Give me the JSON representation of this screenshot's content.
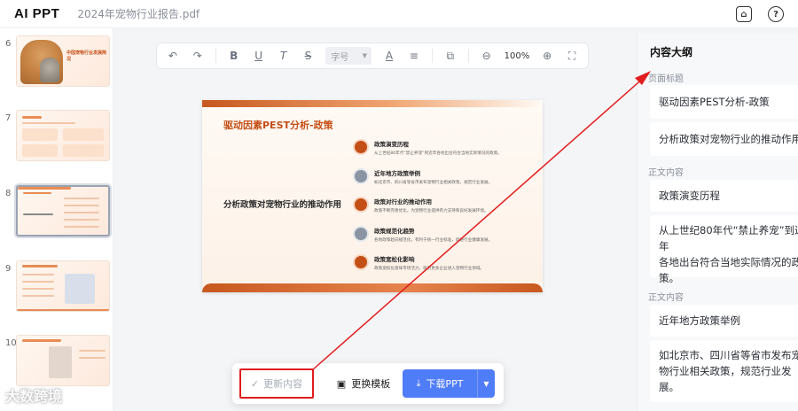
{
  "app": {
    "logo": "AI PPT",
    "filename": "2024年宠物行业报告.pdf"
  },
  "top_icons": [
    "home-icon",
    "help-icon"
  ],
  "thumbnails": [
    {
      "num": "6",
      "title": "中国宠物行业发展简况"
    },
    {
      "num": "7"
    },
    {
      "num": "8"
    },
    {
      "num": "9"
    },
    {
      "num": "10"
    }
  ],
  "toolbar": {
    "font_size_placeholder": "字号",
    "zoom": "100%",
    "buttons": [
      "undo-icon",
      "redo-icon",
      "bold-icon",
      "underline-icon",
      "italic-icon",
      "strikethrough-icon",
      "font-color-icon",
      "align-icon",
      "layout-icon",
      "zoom-out-icon",
      "zoom-in-icon",
      "fit-screen-icon"
    ]
  },
  "slide": {
    "title": "驱动因素PEST分析-政策",
    "subtitle": "分析政策对宠物行业的推动作用",
    "points": [
      {
        "heading": "政策演变历程",
        "desc": "从上世纪80年代“禁止养宠”到近年各地出台符合当地实际情况的政策。"
      },
      {
        "heading": "近年地方政策举例",
        "desc": "如北京市、四川省等省市发布宠物行业相关政策，规范行业发展。"
      },
      {
        "heading": "政策对行业的推动作用",
        "desc": "政策不断完善优化，为宠物行业提供有力支持和良好发展环境。"
      },
      {
        "heading": "政策规范化趋势",
        "desc": "各地政策趋向规范化，有利于统一行业标准，促进行业健康发展。"
      },
      {
        "heading": "政策宽松化影响",
        "desc": "政策宽松化意味市场活力，吸引更多企业进入宠物行业领域。"
      }
    ]
  },
  "outline": {
    "title": "内容大纲",
    "sections": [
      {
        "label": "页面标题",
        "cards": [
          "驱动因素PEST分析-政策",
          "分析政策对宠物行业的推动作用"
        ]
      },
      {
        "label": "正文内容",
        "cards": [
          "政策演变历程",
          "从上世纪80年代“禁止养宠”到近年\n各地出台符合当地实际情况的政\n策。"
        ]
      },
      {
        "label": "正文内容",
        "cards": [
          "近年地方政策举例",
          "如北京市、四川省等省市发布宠\n物行业相关政策，规范行业发\n展。"
        ]
      }
    ]
  },
  "actions": {
    "update": "更新内容",
    "template": "更换模板",
    "download": "下载PPT"
  },
  "watermark": "大数跨境",
  "colors": {
    "accent": "#c44f16",
    "primary_button": "#4f7cf7",
    "annotation_red": "#e11d1d"
  }
}
